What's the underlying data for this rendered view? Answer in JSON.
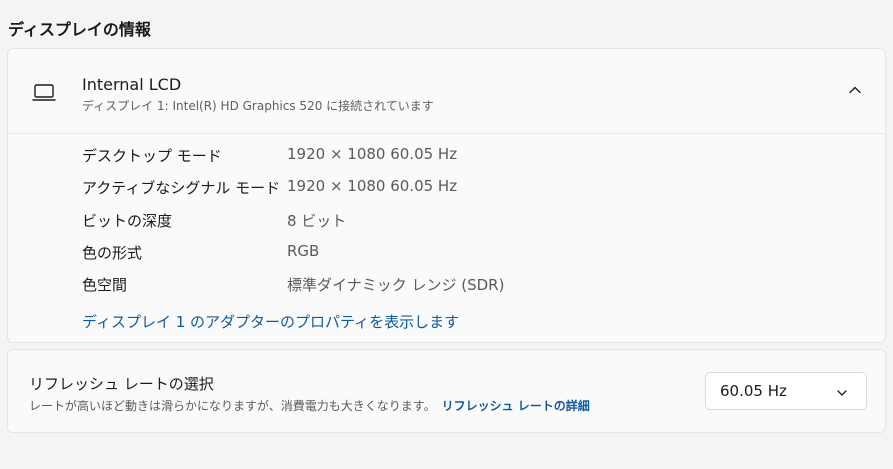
{
  "section_title": "ディスプレイの情報",
  "display": {
    "name": "Internal LCD",
    "subtitle": "ディスプレイ 1: Intel(R) HD Graphics 520 に接続されています",
    "icon": "laptop-icon",
    "expanded": true,
    "properties": [
      {
        "label": "デスクトップ モード",
        "value": "1920 × 1080 60.05 Hz"
      },
      {
        "label": "アクティブなシグナル モード",
        "value": "1920 × 1080 60.05 Hz"
      },
      {
        "label": "ビットの深度",
        "value": "8 ビット"
      },
      {
        "label": "色の形式",
        "value": "RGB"
      },
      {
        "label": "色空間",
        "value": "標準ダイナミック レンジ (SDR)"
      }
    ],
    "adapter_link": "ディスプレイ 1 のアダプターのプロパティを表示します"
  },
  "refresh": {
    "title": "リフレッシュ レートの選択",
    "description": "レートが高いほど動きは滑らかになりますが、消費電力も大きくなります。",
    "details_link": "リフレッシュ レートの詳細",
    "selected": "60.05 Hz"
  },
  "colors": {
    "accent_link": "#0f5a9e",
    "background": "#f6f3f3",
    "card": "#fbfafa"
  }
}
